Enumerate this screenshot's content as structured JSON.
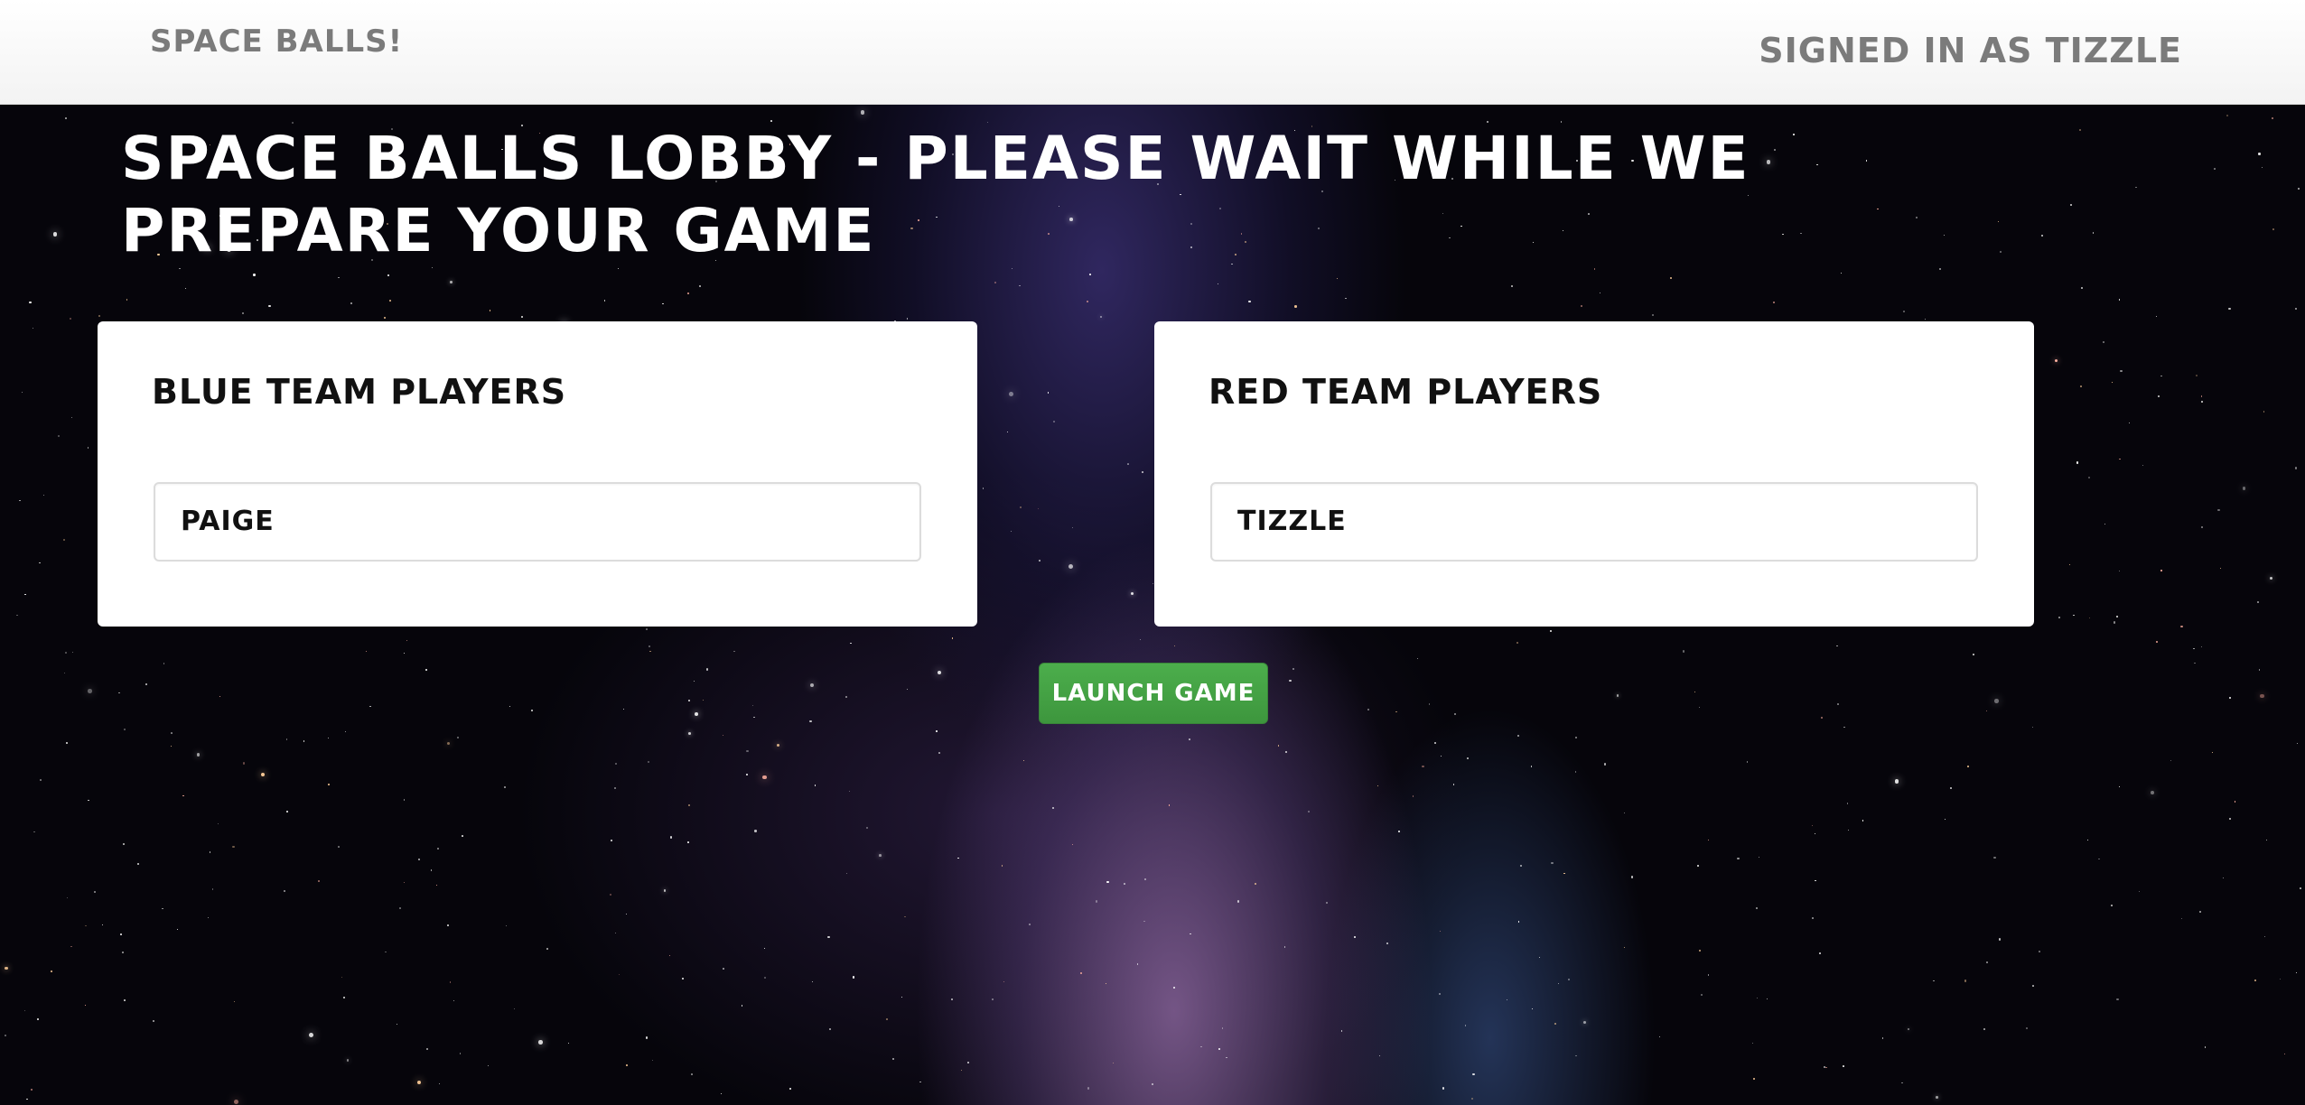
{
  "navbar": {
    "brand": "Space Balls!",
    "signed_in": "Signed in as Tizzle"
  },
  "main": {
    "title": "Space Balls Lobby - Please wait while we prepare your game",
    "launch_button": "Launch Game"
  },
  "teams": {
    "blue": {
      "title": "Blue Team Players",
      "players": [
        "Paige"
      ]
    },
    "red": {
      "title": "Red Team Players",
      "players": [
        "Tizzle"
      ]
    }
  },
  "colors": {
    "launch_button": "#449d44",
    "navbar_text": "#7b7b7b",
    "background": "#06050b"
  }
}
